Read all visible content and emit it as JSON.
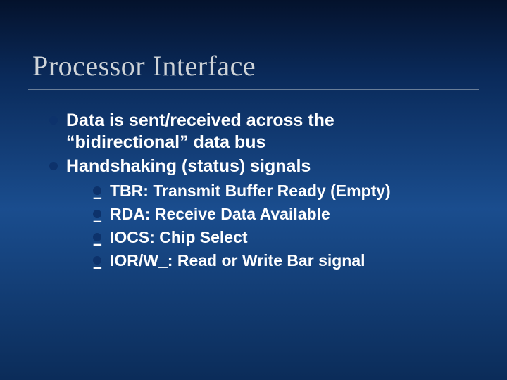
{
  "title": "Processor Interface",
  "bullets": {
    "b0": "Data is sent/received across the “bidirectional” data bus",
    "b1": "Handshaking (status) signals"
  },
  "sub": {
    "s0": "TBR: Transmit Buffer Ready (Empty)",
    "s1": "RDA: Receive Data Available",
    "s2": "IOCS: Chip Select",
    "s3": "IOR/W_: Read or Write Bar signal"
  }
}
